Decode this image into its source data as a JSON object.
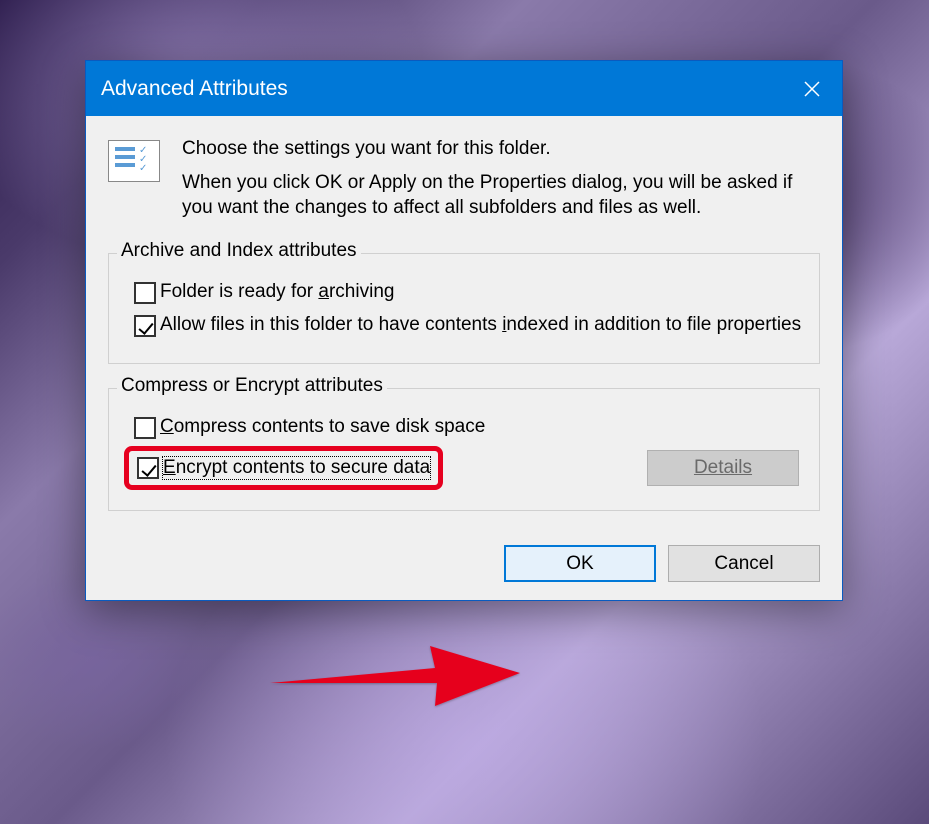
{
  "title": "Advanced Attributes",
  "intro": {
    "line1": "Choose the settings you want for this folder.",
    "line2": "When you click OK or Apply on the Properties dialog, you will be asked if you want the changes to affect all subfolders and files as well."
  },
  "archive_group": {
    "legend": "Archive and Index attributes",
    "archive": {
      "label_pre": "Folder is ready for ",
      "label_key": "a",
      "label_post": "rchiving",
      "checked": false
    },
    "index": {
      "label_pre": "Allow files in this folder to have contents ",
      "label_key": "i",
      "label_post": "ndexed in addition to file properties",
      "checked": true
    }
  },
  "compress_group": {
    "legend": "Compress or Encrypt attributes",
    "compress": {
      "label_pre": "",
      "label_key": "C",
      "label_post": "ompress contents to save disk space",
      "checked": false
    },
    "encrypt": {
      "label_pre": "",
      "label_key": "E",
      "label_post": "ncrypt contents to secure data",
      "checked": true
    },
    "details_label": "Details"
  },
  "buttons": {
    "ok": "OK",
    "cancel": "Cancel"
  }
}
